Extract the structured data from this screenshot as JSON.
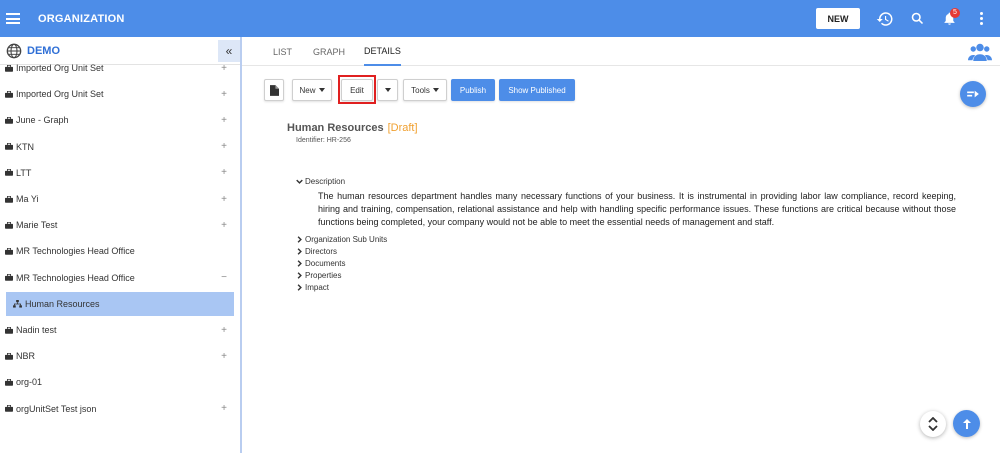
{
  "header": {
    "title": "ORGANIZATION",
    "new_label": "NEW",
    "notification_count": "5",
    "bar_color": "#4d8de8"
  },
  "sidebar": {
    "title": "DEMO",
    "items": [
      {
        "label": "Imported Org Unit Set",
        "toggle": "+"
      },
      {
        "label": "Imported Org Unit Set",
        "toggle": "+"
      },
      {
        "label": "June - Graph",
        "toggle": "+"
      },
      {
        "label": "KTN",
        "toggle": "+"
      },
      {
        "label": "LTT",
        "toggle": "+"
      },
      {
        "label": "Ma Yi",
        "toggle": "+"
      },
      {
        "label": "Marie Test",
        "toggle": "+"
      },
      {
        "label": "MR Technologies Head Office",
        "toggle": ""
      },
      {
        "label": "MR Technologies Head Office",
        "toggle": "−"
      },
      {
        "label": "Human Resources",
        "toggle": ""
      },
      {
        "label": "Nadin test",
        "toggle": "+"
      },
      {
        "label": "NBR",
        "toggle": "+"
      },
      {
        "label": "org-01",
        "toggle": ""
      },
      {
        "label": "orgUnitSet Test json",
        "toggle": "+"
      }
    ],
    "selected_index": 9
  },
  "tabs": [
    {
      "label": "LIST"
    },
    {
      "label": "GRAPH"
    },
    {
      "label": "DETAILS"
    }
  ],
  "active_tab": "DETAILS",
  "toolbar": {
    "new_label": "New",
    "edit_label": "Edit",
    "tools_label": "Tools",
    "publish_label": "Publish",
    "show_published_label": "Show Published"
  },
  "entity": {
    "name": "Human Resources",
    "status": "[Draft]",
    "identifier": "Identifier:  HR-256"
  },
  "sections": {
    "description_title": "Description",
    "description_text": "The human resources department handles many necessary functions of your business. It is instrumental in providing labor law compliance, record keeping, hiring and training, compensation, relational assistance and help with handling specific performance issues. These functions are critical because without those functions being completed, your company would not be able to meet the essential needs of management and staff.",
    "collapsed": [
      "Organization Sub Units",
      "Directors",
      "Documents",
      "Properties",
      "Impact"
    ]
  },
  "icons": {
    "menu": "hamburger-icon",
    "history": "history-icon",
    "search": "search-icon",
    "notifications": "bell-icon",
    "more": "kebab-icon",
    "globe": "globe-icon",
    "collapse": "double-chevron-left-icon",
    "people": "people-icon",
    "share": "share-icon",
    "sort": "sort-icon",
    "scroll_top": "arrow-up-icon",
    "document": "document-icon"
  }
}
